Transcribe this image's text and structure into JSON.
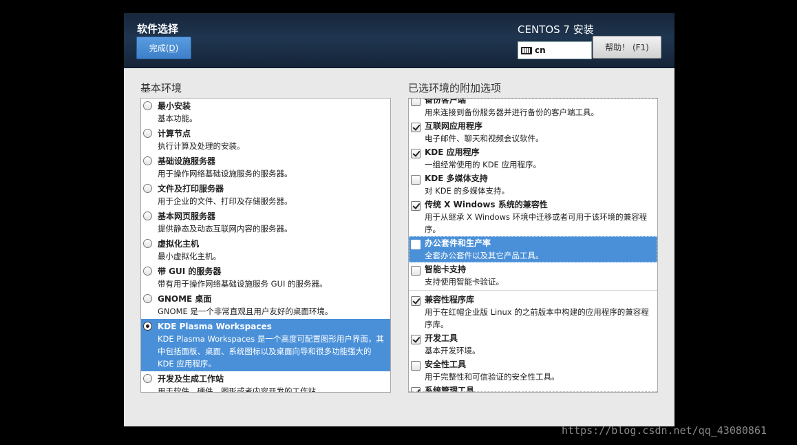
{
  "header": {
    "title": "软件选择",
    "done_prefix": "完成(",
    "done_key": "D",
    "done_suffix": ")",
    "product": "CENTOS 7 安装",
    "keyboard_layout": "cn",
    "help_label": "帮助！ (F1)"
  },
  "environments": {
    "label": "基本环境",
    "items": [
      {
        "name": "最小安装",
        "desc": "基本功能。",
        "selected": false
      },
      {
        "name": "计算节点",
        "desc": "执行计算及处理的安装。",
        "selected": false
      },
      {
        "name": "基础设施服务器",
        "desc": "用于操作网络基础设施服务的服务器。",
        "selected": false
      },
      {
        "name": "文件及打印服务器",
        "desc": "用于企业的文件、打印及存储服务器。",
        "selected": false
      },
      {
        "name": "基本网页服务器",
        "desc": "提供静态及动态互联网内容的服务器。",
        "selected": false
      },
      {
        "name": "虚拟化主机",
        "desc": "最小虚拟化主机。",
        "selected": false
      },
      {
        "name": "带 GUI 的服务器",
        "desc": "带有用于操作网络基础设施服务 GUI 的服务器。",
        "selected": false
      },
      {
        "name": "GNOME 桌面",
        "desc": "GNOME 是一个非常直观且用户友好的桌面环境。",
        "selected": false
      },
      {
        "name": "KDE Plasma Workspaces",
        "desc": "KDE Plasma Workspaces 是一个高度可配置图形用户界面，其中包括面板、桌面、系统图标以及桌面向导和很多功能强大的 KDE 应用程序。",
        "selected": true
      },
      {
        "name": "开发及生成工作站",
        "desc": "用于软件、硬件、图形或者内容开发的工作站。",
        "selected": false
      }
    ]
  },
  "addons": {
    "label": "已选环境的附加选项",
    "items": [
      {
        "name": "备份客户端",
        "desc": "用来连接到备份服务器并进行备份的客户端工具。",
        "checked": false,
        "selected": false
      },
      {
        "name": "互联网应用程序",
        "desc": "电子邮件、聊天和视频会议软件。",
        "checked": true,
        "selected": false
      },
      {
        "name": "KDE 应用程序",
        "desc": "一组经常使用的 KDE 应用程序。",
        "checked": true,
        "selected": false
      },
      {
        "name": "KDE 多媒体支持",
        "desc": "对 KDE 的多媒体支持。",
        "checked": false,
        "selected": false
      },
      {
        "name": "传统 X Windows 系统的兼容性",
        "desc": "用于从继承 X Windows 环境中迁移或者可用于该环境的兼容程序。",
        "checked": true,
        "selected": false
      },
      {
        "name": "办公套件和生产率",
        "desc": "全套办公套件以及其它产品工具。",
        "checked": false,
        "selected": true
      },
      {
        "name": "智能卡支持",
        "desc": "支持使用智能卡验证。",
        "checked": false,
        "selected": false
      },
      {
        "name": "兼容性程序库",
        "desc": "用于在红帽企业版 Linux 的之前版本中构建的应用程序的兼容程序库。",
        "checked": true,
        "selected": false
      },
      {
        "name": "开发工具",
        "desc": "基本开发环境。",
        "checked": true,
        "selected": false
      },
      {
        "name": "安全性工具",
        "desc": "用于完整性和可信验证的安全性工具。",
        "checked": false,
        "selected": false
      },
      {
        "name": "系统管理工具",
        "desc": "",
        "checked": true,
        "selected": false
      }
    ]
  },
  "watermark": "https://blog.csdn.net/qq_43080861"
}
